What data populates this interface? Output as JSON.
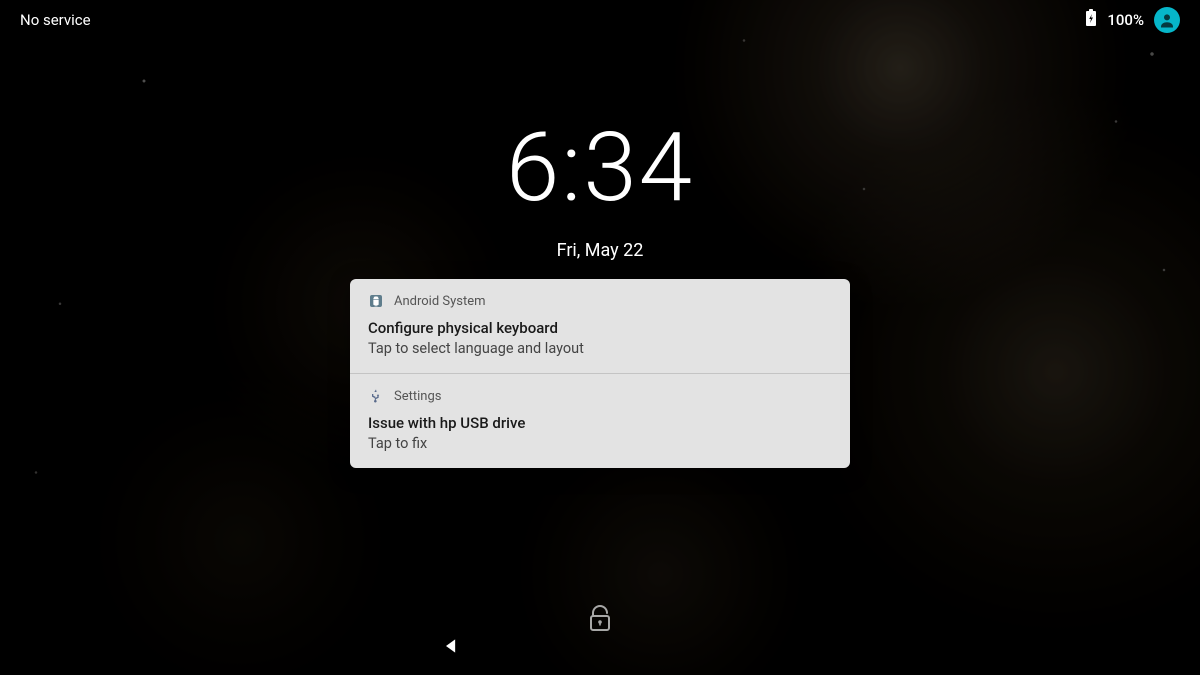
{
  "status": {
    "network_text": "No service",
    "battery_pct": "100%"
  },
  "clock": {
    "time": "6:34",
    "date": "Fri, May 22"
  },
  "notifications": [
    {
      "app": "Android System",
      "title": "Configure physical keyboard",
      "text": "Tap to select language and layout",
      "icon": "android-icon"
    },
    {
      "app": "Settings",
      "title": "Issue with hp USB drive",
      "text": "Tap to fix",
      "icon": "usb-icon"
    }
  ]
}
